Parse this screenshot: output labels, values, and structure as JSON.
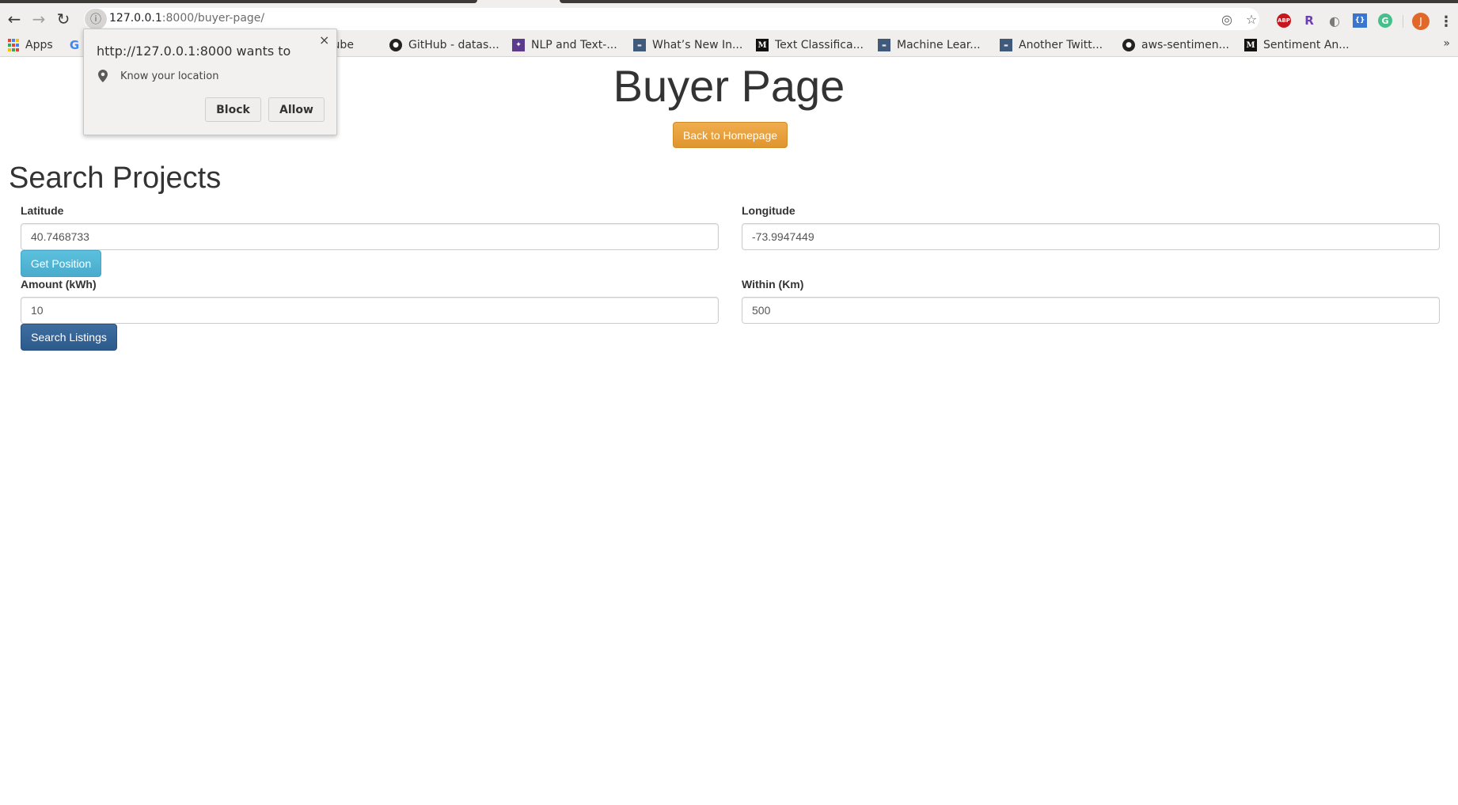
{
  "browser": {
    "url_host": "127.0.0.1",
    "url_rest": ":8000/buyer-page/",
    "nav": {
      "back_icon": "arrow-left-icon",
      "forward_icon": "arrow-right-icon",
      "reload_icon": "reload-icon",
      "site_info_icon": "info-icon"
    },
    "omnibox_icons": [
      "location-target-icon",
      "star-icon"
    ],
    "extensions": [
      {
        "name": "adblock-plus",
        "label": "ABP"
      },
      {
        "name": "r-extension",
        "label": "R"
      },
      {
        "name": "q-extension",
        "label": "◐"
      },
      {
        "name": "json-extension",
        "label": "{}"
      },
      {
        "name": "grammarly",
        "label": "G"
      }
    ],
    "avatar_initial": "J",
    "menu_icon": "⋮"
  },
  "bookmarks": [
    {
      "label": "Apps",
      "icon": "apps"
    },
    {
      "label": "",
      "icon": "google"
    },
    {
      "label": "YouTube",
      "icon": "youtube"
    },
    {
      "label": "GitHub - datas...",
      "icon": "github"
    },
    {
      "label": "NLP and Text-...",
      "icon": "nlp"
    },
    {
      "label": "What’s New In...",
      "icon": "doc"
    },
    {
      "label": "Text Classifica...",
      "icon": "medium"
    },
    {
      "label": "Machine Lear...",
      "icon": "doc"
    },
    {
      "label": "Another Twitt...",
      "icon": "doc"
    },
    {
      "label": "aws-sentimen...",
      "icon": "github"
    },
    {
      "label": "Sentiment An...",
      "icon": "medium"
    }
  ],
  "bookmarks_more": "»",
  "permission_popup": {
    "title": "http://127.0.0.1:8000 wants to",
    "close": "×",
    "permission": "Know your location",
    "block_label": "Block",
    "allow_label": "Allow"
  },
  "page": {
    "title": "Buyer Page",
    "back_button": "Back to Homepage",
    "section_title": "Search Projects",
    "form": {
      "latitude_label": "Latitude",
      "latitude_value": "40.7468733",
      "longitude_label": "Longitude",
      "longitude_value": "-73.9947449",
      "get_position_button": "Get Position",
      "amount_label": "Amount (kWh)",
      "amount_value": "10",
      "within_label": "Within (Km)",
      "within_value": "500",
      "search_button": "Search Listings"
    }
  },
  "colors": {
    "warning": "#f0ad4e",
    "info": "#5bc0de",
    "primary": "#337ab7"
  }
}
